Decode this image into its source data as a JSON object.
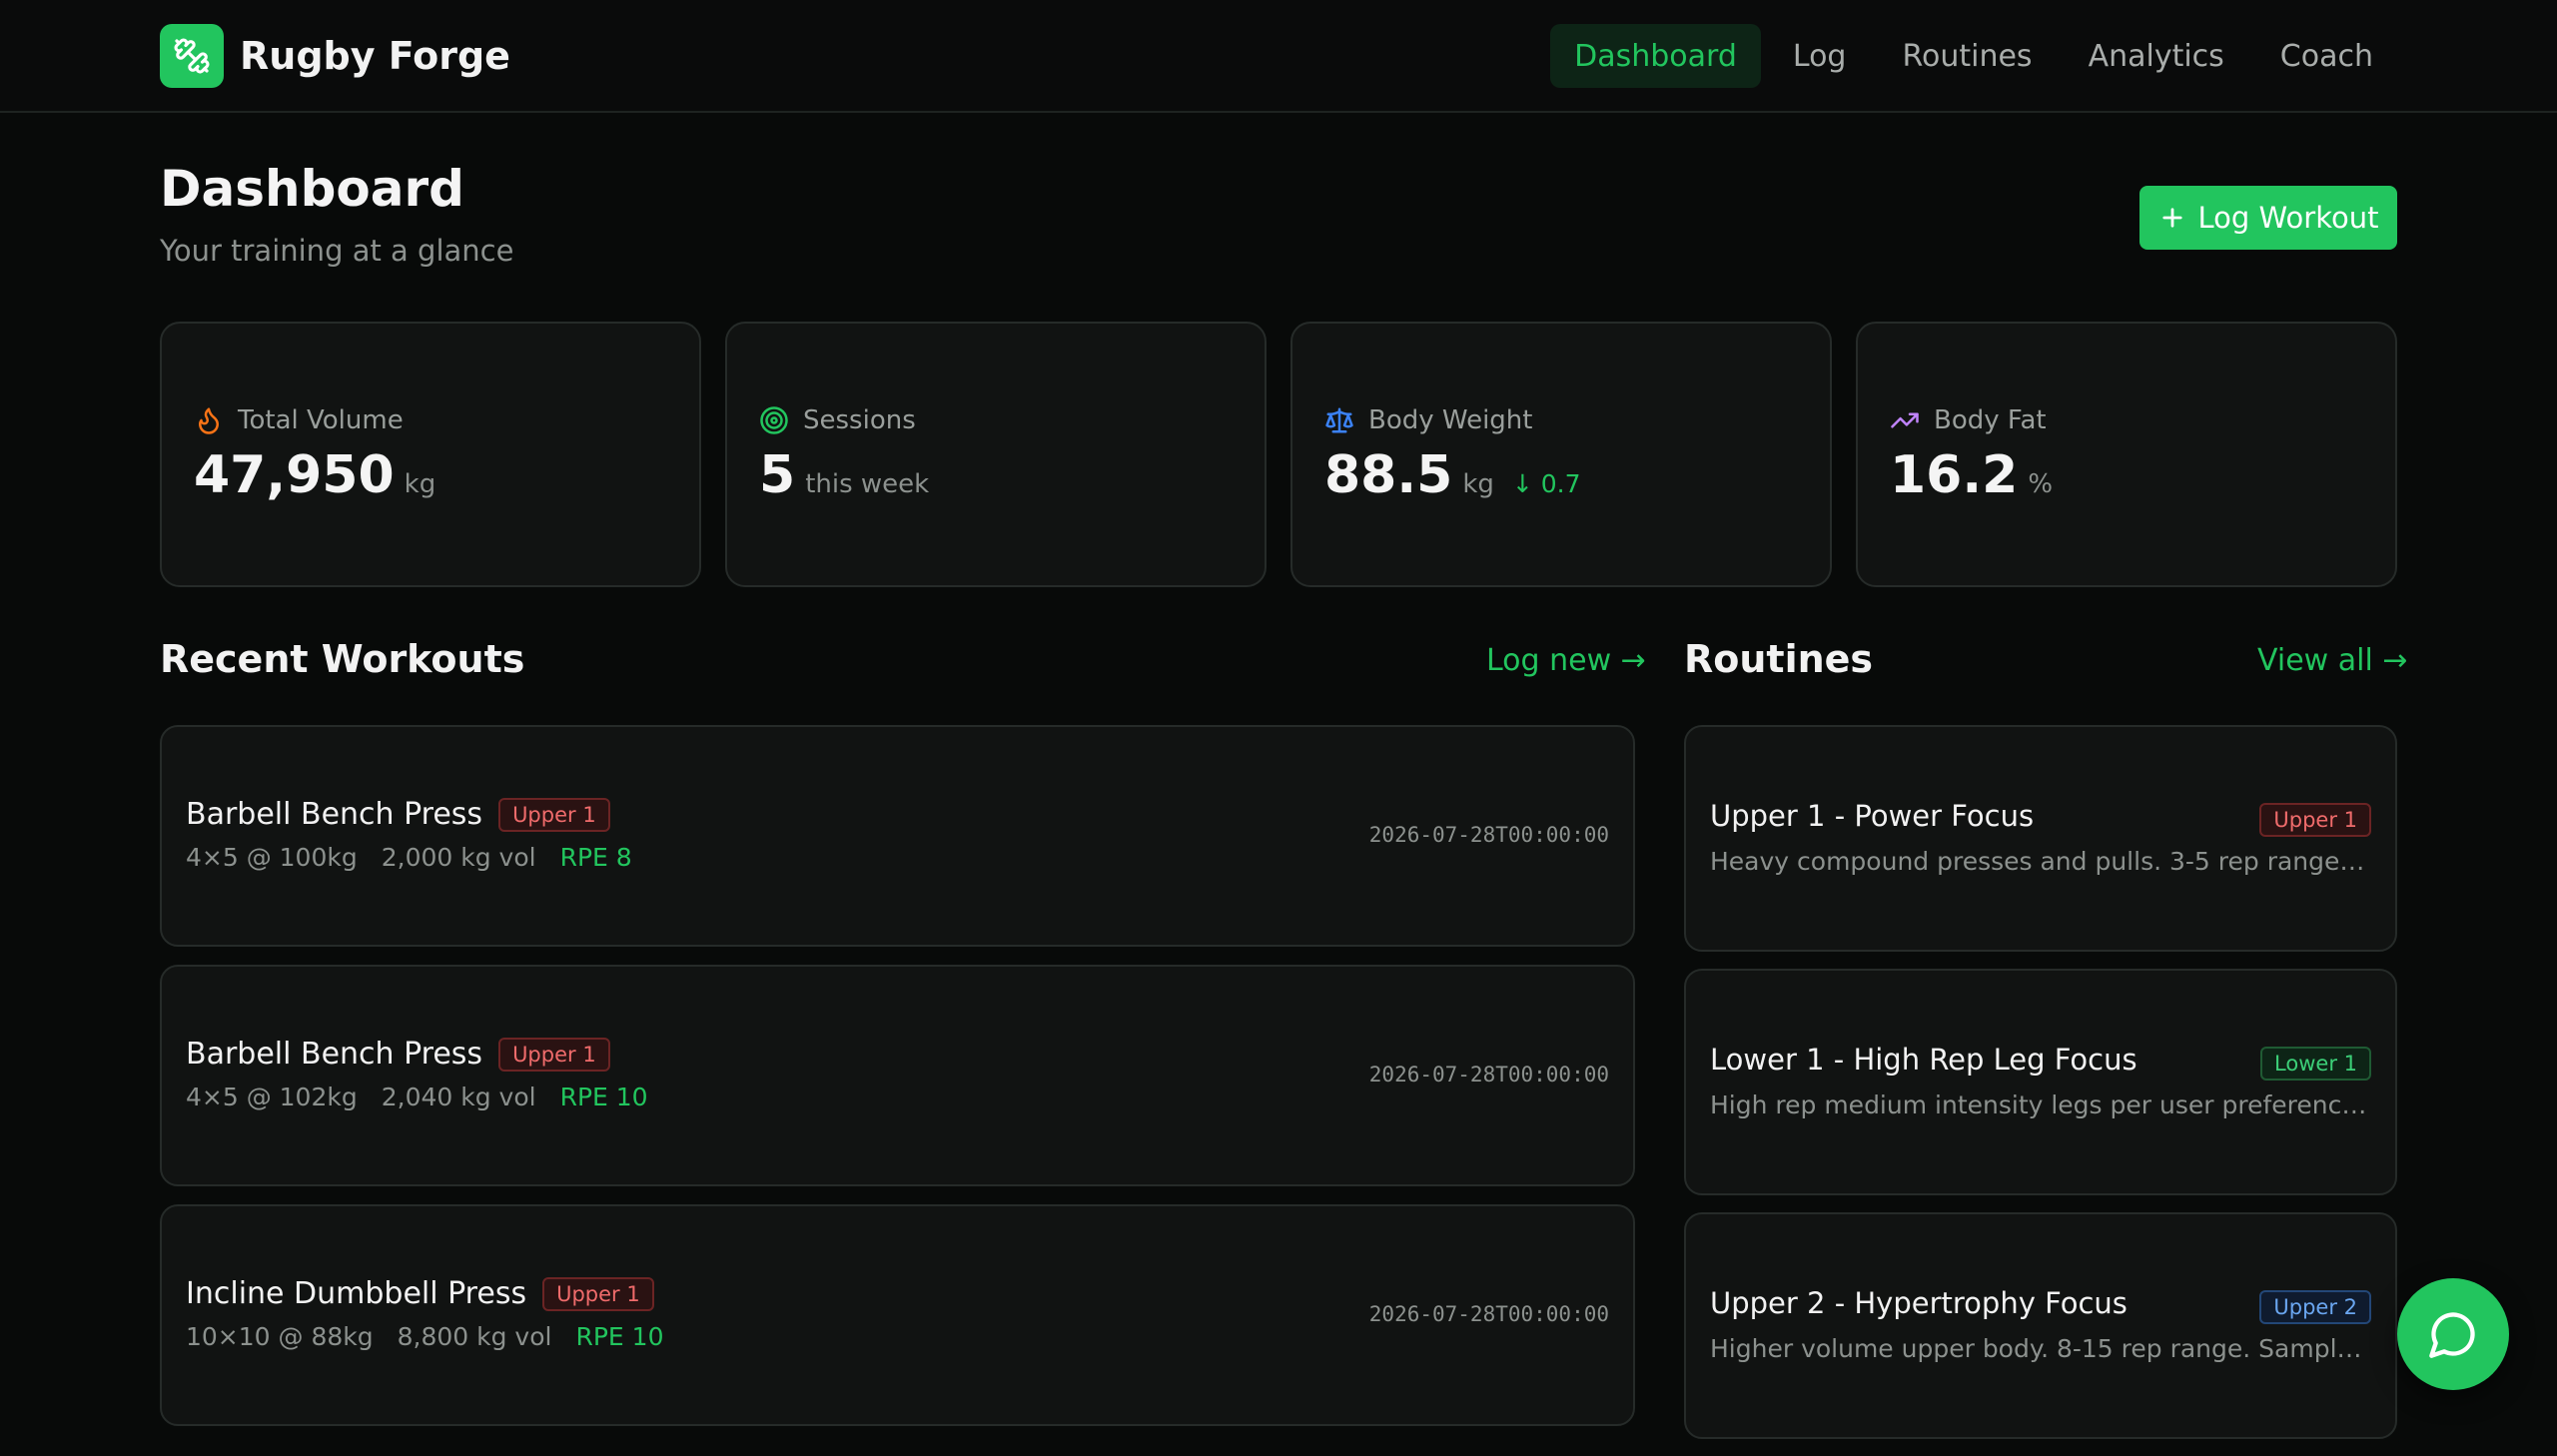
{
  "app": {
    "name": "Rugby Forge",
    "logo_icon": "dumbbell-icon",
    "accent": "#22c55e"
  },
  "nav": {
    "items": [
      {
        "label": "Dashboard",
        "active": true
      },
      {
        "label": "Log",
        "active": false
      },
      {
        "label": "Routines",
        "active": false
      },
      {
        "label": "Analytics",
        "active": false
      },
      {
        "label": "Coach",
        "active": false
      }
    ]
  },
  "header": {
    "title": "Dashboard",
    "subtitle": "Your training at a glance",
    "log_button": "Log Workout"
  },
  "stats": [
    {
      "icon": "flame-icon",
      "label": "Total Volume",
      "value": "47,950",
      "unit": "kg",
      "delta": ""
    },
    {
      "icon": "target-icon",
      "label": "Sessions",
      "value": "5",
      "unit": "this week",
      "delta": ""
    },
    {
      "icon": "scale-icon",
      "label": "Body Weight",
      "value": "88.5",
      "unit": "kg",
      "delta": "↓ 0.7"
    },
    {
      "icon": "trending-up-icon",
      "label": "Body Fat",
      "value": "16.2",
      "unit": "%",
      "delta": ""
    }
  ],
  "recent_workouts": {
    "title": "Recent Workouts",
    "link": "Log new",
    "items": [
      {
        "name": "Barbell Bench Press",
        "tag": "Upper 1",
        "sets": "4×5 @ 100kg",
        "volume": "2,000 kg vol",
        "rpe": "RPE 8",
        "date": "2026-07-28T00:00:00"
      },
      {
        "name": "Barbell Bench Press",
        "tag": "Upper 1",
        "sets": "4×5 @ 102kg",
        "volume": "2,040 kg vol",
        "rpe": "RPE 10",
        "date": "2026-07-28T00:00:00"
      },
      {
        "name": "Incline Dumbbell Press",
        "tag": "Upper 1",
        "sets": "10×10 @ 88kg",
        "volume": "8,800 kg vol",
        "rpe": "RPE 10",
        "date": "2026-07-28T00:00:00"
      }
    ]
  },
  "routines": {
    "title": "Routines",
    "link": "View all",
    "items": [
      {
        "name": "Upper 1 - Power Focus",
        "tag": "Upper 1",
        "tag_color": "red",
        "desc": "Heavy compound presses and pulls. 3-5 rep range o..."
      },
      {
        "name": "Lower 1 - High Rep Leg Focus",
        "tag": "Lower 1",
        "tag_color": "green",
        "desc": "High rep medium intensity legs per user preference...."
      },
      {
        "name": "Upper 2 - Hypertrophy Focus",
        "tag": "Upper 2",
        "tag_color": "blue",
        "desc": "Higher volume upper body. 8-15 rep range. Sample..."
      }
    ]
  },
  "chat": {
    "icon": "chat-bubble-icon"
  }
}
